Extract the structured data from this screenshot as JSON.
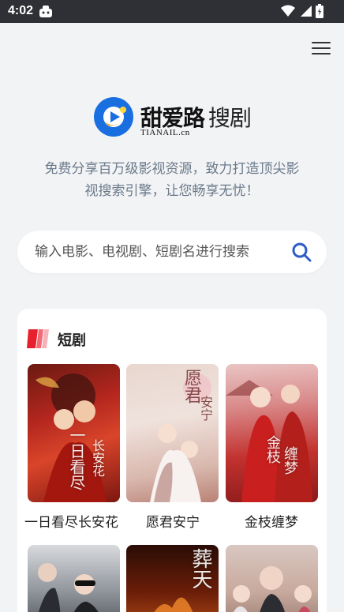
{
  "status_bar": {
    "time": "4:02"
  },
  "header": {
    "menu_icon": "menu-icon"
  },
  "logo": {
    "brand": "甜爱路",
    "suffix": "搜剧",
    "sub": "TIANAIL.cn"
  },
  "slogan": {
    "line1": "免费分享百万级影视资源，致力打造顶尖影",
    "line2": "视搜索引擎，让您畅享无忧！"
  },
  "search": {
    "placeholder": "输入电影、电视剧、短剧名进行搜索"
  },
  "section": {
    "title": "短剧",
    "items": [
      {
        "title": "一日看尽长安花"
      },
      {
        "title": "愿君安宁"
      },
      {
        "title": "金枝缠梦"
      }
    ]
  },
  "colors": {
    "accent_blue": "#1a6fe0",
    "flag_red": "#e8202d",
    "search_icon": "#2e5cc6"
  }
}
